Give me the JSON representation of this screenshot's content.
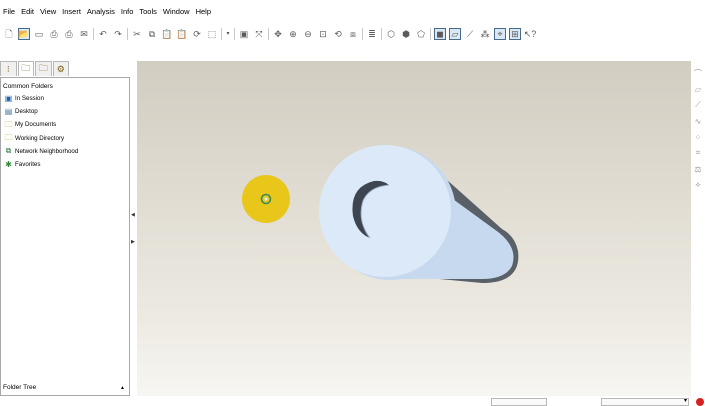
{
  "menubar": {
    "items": [
      "File",
      "Edit",
      "View",
      "Insert",
      "Analysis",
      "Info",
      "Tools",
      "Window",
      "Help"
    ]
  },
  "toolbar": {
    "buttons": [
      {
        "name": "new-icon",
        "glyph": "🗋"
      },
      {
        "name": "open-icon",
        "glyph": "📂",
        "active": true
      },
      {
        "name": "save-icon",
        "glyph": "▭"
      },
      {
        "name": "print-icon",
        "glyph": "⎙"
      },
      {
        "name": "print-preview-icon",
        "glyph": "⎙"
      },
      {
        "name": "email-icon",
        "glyph": "✉"
      },
      {
        "name": "undo-icon",
        "glyph": "↶"
      },
      {
        "name": "redo-icon",
        "glyph": "↷"
      },
      {
        "name": "cut-icon",
        "glyph": "✂"
      },
      {
        "name": "copy-icon",
        "glyph": "⧉"
      },
      {
        "name": "paste-icon",
        "glyph": "📋"
      },
      {
        "name": "paste-special-icon",
        "glyph": "📋"
      },
      {
        "name": "regenerate-icon",
        "glyph": "⟳"
      },
      {
        "name": "select-box-icon",
        "glyph": "⬚"
      },
      {
        "name": "dropdown-arrow-icon",
        "glyph": "▾"
      },
      {
        "name": "window-icon",
        "glyph": "▣"
      },
      {
        "name": "spin-center-icon",
        "glyph": "⤧"
      },
      {
        "name": "pan-icon",
        "glyph": "✥"
      },
      {
        "name": "zoom-in-icon",
        "glyph": "⊕"
      },
      {
        "name": "zoom-out-icon",
        "glyph": "⊖"
      },
      {
        "name": "refit-icon",
        "glyph": "⊡"
      },
      {
        "name": "reorient-icon",
        "glyph": "⟲"
      },
      {
        "name": "saved-views-icon",
        "glyph": "⧈"
      },
      {
        "name": "layers-icon",
        "glyph": "≣"
      },
      {
        "name": "wireframe-icon",
        "glyph": "⬡"
      },
      {
        "name": "hidden-line-icon",
        "glyph": "⬢"
      },
      {
        "name": "no-hidden-icon",
        "glyph": "⬠"
      },
      {
        "name": "shading-icon",
        "glyph": "◼",
        "active": true
      },
      {
        "name": "datum-planes-icon",
        "glyph": "▱",
        "active": true
      },
      {
        "name": "datum-axes-icon",
        "glyph": "⟋"
      },
      {
        "name": "datum-points-icon",
        "glyph": "⁂"
      },
      {
        "name": "csys-icon",
        "glyph": "⌖",
        "active": true
      },
      {
        "name": "annotations-icon",
        "glyph": "⊞",
        "active": true
      },
      {
        "name": "context-help-icon",
        "glyph": "↖?"
      }
    ]
  },
  "navigator": {
    "tabs": [
      {
        "name": "model-tree-tab-icon",
        "glyph": "⁝"
      },
      {
        "name": "folder-browser-tab-icon",
        "glyph": "🗀",
        "selected": true
      },
      {
        "name": "favorites-tab-icon",
        "glyph": "🗀"
      },
      {
        "name": "connections-tab-icon",
        "glyph": "⚙"
      }
    ],
    "heading": "Common Folders",
    "folders": [
      {
        "label": "In Session",
        "icon": "monitor-icon",
        "glyph": "▣",
        "color": "#1e5fb4"
      },
      {
        "label": "Desktop",
        "icon": "desktop-icon",
        "glyph": "▤",
        "color": "#3d6e9e"
      },
      {
        "label": "My Documents",
        "icon": "documents-icon",
        "glyph": "🗀",
        "color": "#c9a227"
      },
      {
        "label": "Working Directory",
        "icon": "working-directory-icon",
        "glyph": "🗀",
        "color": "#c9a227"
      },
      {
        "label": "Network Neighborhood",
        "icon": "network-icon",
        "glyph": "⧉",
        "color": "#2a7a3a"
      },
      {
        "label": "Favorites",
        "icon": "favorites-icon",
        "glyph": "✱",
        "color": "#2a8a3a"
      }
    ],
    "footer_label": "Folder Tree",
    "footer_arrow": "▲"
  },
  "splitter": {
    "top_arrow": "◀",
    "bottom_arrow": "▶"
  },
  "side_toolbar": {
    "buttons": [
      {
        "name": "sketch-icon",
        "glyph": "⌒"
      },
      {
        "name": "plane-icon",
        "glyph": "▱"
      },
      {
        "name": "axis-icon",
        "glyph": "⟋"
      },
      {
        "name": "curve-icon",
        "glyph": "∿"
      },
      {
        "name": "point-icon",
        "glyph": "⁘"
      },
      {
        "name": "csys-tool-icon",
        "glyph": "⌗"
      },
      {
        "name": "analysis-icon",
        "glyph": "⚖"
      },
      {
        "name": "datum-ref-icon",
        "glyph": "⟡"
      }
    ]
  },
  "viewport": {
    "colors": {
      "part_face": "#dbe9f8",
      "part_side": "#c7d9ee",
      "part_shadow": "#5a6068",
      "cursor_highlight": "#e8c61a",
      "cursor_center": "#3c8a5c"
    }
  },
  "statusbar": {
    "stop_color": "#d82020"
  }
}
